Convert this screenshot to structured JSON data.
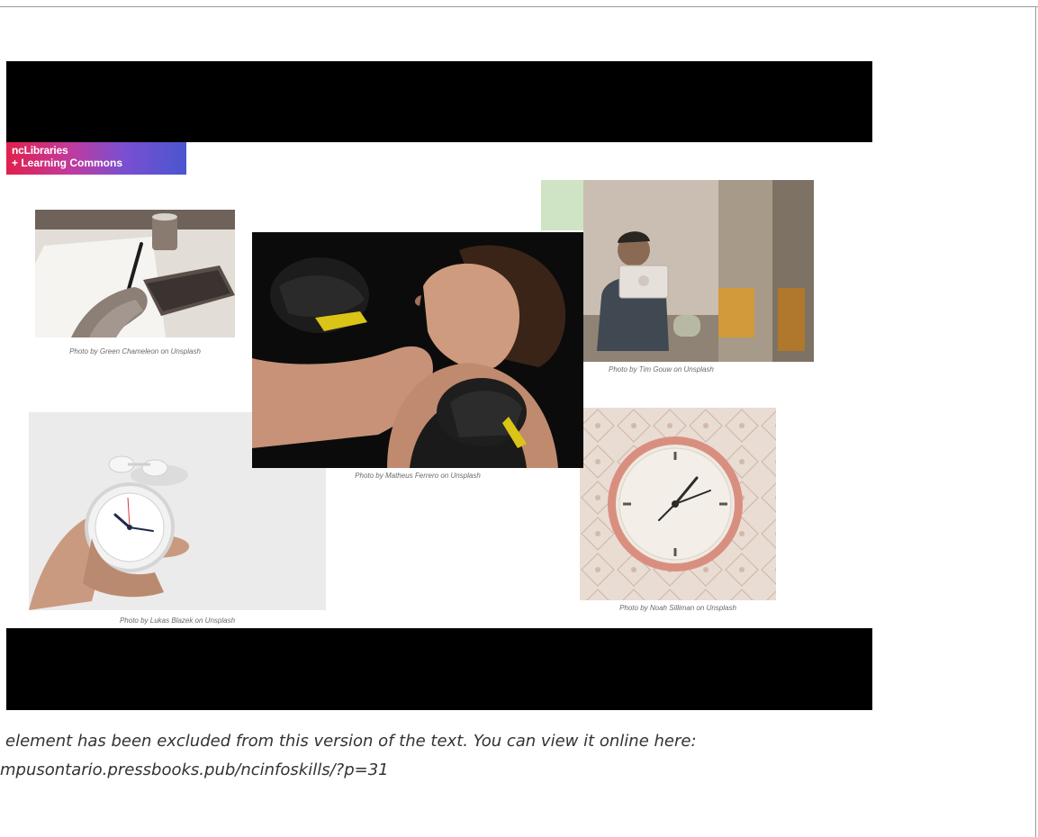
{
  "slide": {
    "logo": {
      "line1": "ncLibraries",
      "line2": "+ Learning Commons"
    },
    "captions": {
      "writing": "Photo by Green Chameleon on Unsplash",
      "boxer": "Photo by Matheus Ferrero on Unsplash",
      "laptop": "Photo by Tim Gouw on Unsplash",
      "hand_clock": "Photo by Lukas Blazek on Unsplash",
      "wall_clock": "Photo by Noah Silliman on Unsplash"
    }
  },
  "notice": {
    "line1": "element has been excluded from this version of the text. You can view it online here:",
    "line2": "mpusontario.pressbooks.pub/ncinfoskills/?p=31"
  },
  "colors": {
    "frame": "#000000",
    "logo_start": "#e0204e",
    "logo_end": "#4a56cf",
    "text": "#333333"
  }
}
